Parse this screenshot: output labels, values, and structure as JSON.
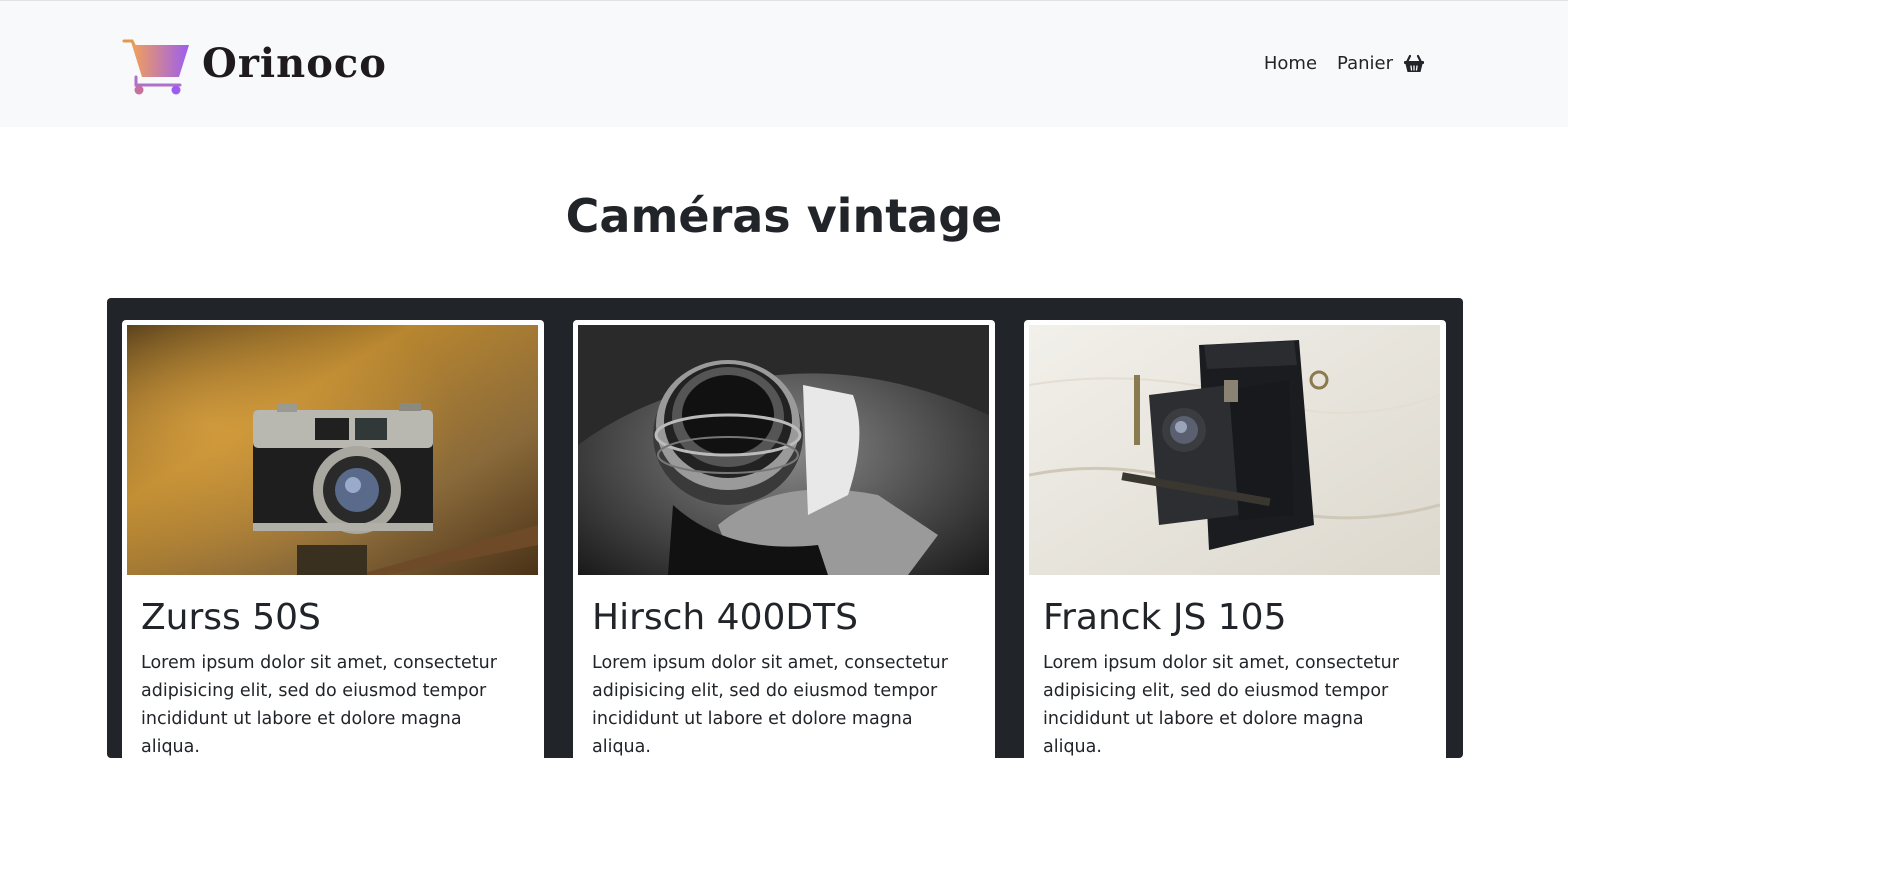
{
  "brand": {
    "name": "Orinoco",
    "logo_colors": [
      "#f2a05a",
      "#9c5ef0"
    ]
  },
  "nav": {
    "home_label": "Home",
    "cart_label": "Panier",
    "cart_icon": "basket-icon"
  },
  "page": {
    "title": "Caméras vintage"
  },
  "products": [
    {
      "name": "Zurss 50S",
      "description": "Lorem ipsum dolor sit amet, consectetur adipisicing elit, sed do eiusmod tempor incididunt ut labore et dolore magna aliqua.",
      "image": "vintage-rangefinder-camera-photo"
    },
    {
      "name": "Hirsch 400DTS",
      "description": "Lorem ipsum dolor sit amet, consectetur adipisicing elit, sed do eiusmod tempor incididunt ut labore et dolore magna aliqua.",
      "image": "black-and-white-lens-camera-photo"
    },
    {
      "name": "Franck JS 105",
      "description": "Lorem ipsum dolor sit amet, consectetur adipisicing elit, sed do eiusmod tempor incididunt ut labore et dolore magna aliqua.",
      "image": "folding-bellows-camera-photo"
    }
  ]
}
